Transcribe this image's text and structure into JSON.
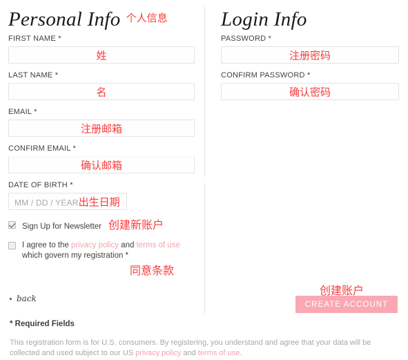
{
  "personal": {
    "heading": "Personal Info",
    "heading_cn": "个人信息",
    "fields": [
      {
        "label": "FIRST NAME *",
        "value": "姓"
      },
      {
        "label": "LAST NAME *",
        "value": "名"
      },
      {
        "label": "EMAIL *",
        "value": "注册邮箱"
      },
      {
        "label": "CONFIRM EMAIL *",
        "value": "确认邮箱"
      }
    ],
    "dob": {
      "label": "DATE OF BIRTH *",
      "placeholder": "MM / DD / YEAR",
      "annotation": "出生日期"
    }
  },
  "login": {
    "heading": "Login Info",
    "fields": [
      {
        "label": "PASSWORD *",
        "value": "注册密码"
      },
      {
        "label": "CONFIRM PASSWORD *",
        "value": "确认密码"
      }
    ]
  },
  "checkboxes": {
    "newsletter": {
      "label": "Sign Up for Newsletter",
      "annotation": "创建新账户",
      "checked": true
    },
    "terms": {
      "prefix": "I agree to the ",
      "link1": "privacy policy",
      "middle": " and ",
      "link2": "terms of use",
      "suffix": "which govern my registration *",
      "annotation": "同意条款",
      "checked": false
    }
  },
  "back": {
    "label": "back"
  },
  "cta": {
    "annotation": "创建账户",
    "label": "CREATE ACCOUNT"
  },
  "footer": {
    "required": "* Required Fields",
    "legal_prefix": "This registration form is for U.S. consumers. By registering, you understand and agree that your data will be collected and used subject to our US ",
    "legal_link1": "privacy policy",
    "legal_middle": " and ",
    "legal_link2": "terms of use",
    "legal_suffix": "."
  },
  "colors": {
    "accent_pink": "#f9a8b4",
    "link_pink": "#f4a3ac",
    "annotation_red": "#fa3c3c",
    "border_gray": "#e3e3e3"
  }
}
